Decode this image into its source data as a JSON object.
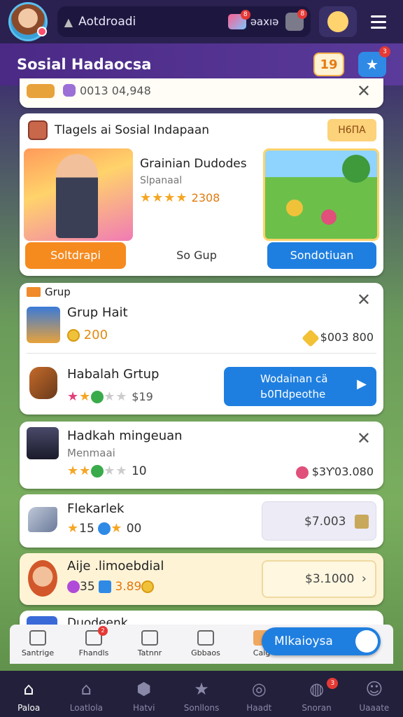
{
  "topbar": {
    "search_text": "Aotdroadi",
    "cubes_badge": "8",
    "score": "əaxıə",
    "gift_badge": "8"
  },
  "header": {
    "title": "Sosial Hadaocsa",
    "badge_number": "19",
    "star_badge": "3"
  },
  "card0": {
    "amount": "0013 04,948"
  },
  "featured": {
    "title": "Tlagels ai Sosial Indapaan",
    "tag": "H6ПA",
    "game_title": "Grainian Dudodes",
    "game_subtitle": "Slpanaal",
    "rating": "2308",
    "left_button": "Soltdrapi",
    "middle_button": "So Gup",
    "right_button": "Sondotiuan"
  },
  "grup": {
    "section_label": "Grup",
    "item1_title": "Grup Hait",
    "item1_coins": "200",
    "item1_price": "$003 800",
    "item2_title": "Habalah Grtup",
    "item2_value": "$19",
    "item2_button_line1": "Wodainan cä",
    "item2_button_line2": "Ь0Пdpeothe"
  },
  "card3": {
    "title": "Hadkah mingeuan",
    "subtitle": "Menmaai",
    "value": "10",
    "price": "$3Ƴ03.080"
  },
  "card4": {
    "title": "Flekarlek",
    "value1": "15",
    "value2": "00",
    "price": "$7.003"
  },
  "card5": {
    "title": "Aije .limoebdial",
    "value1": "35",
    "value2": "3.89",
    "price": "$3.1000"
  },
  "card6": {
    "title": "Duodeenk"
  },
  "nav1": {
    "items": [
      "Santrige",
      "Fhandls",
      "Tatnnr",
      "Gbbaos",
      "Caig"
    ],
    "badge": "2",
    "fab_label": "Mlkaioysa"
  },
  "nav2": {
    "items": [
      "Paloa",
      "Loatlola",
      "Hatvi",
      "Sonllons",
      "Haadt",
      "Snoran",
      "Uaaate"
    ],
    "badge": "3"
  }
}
